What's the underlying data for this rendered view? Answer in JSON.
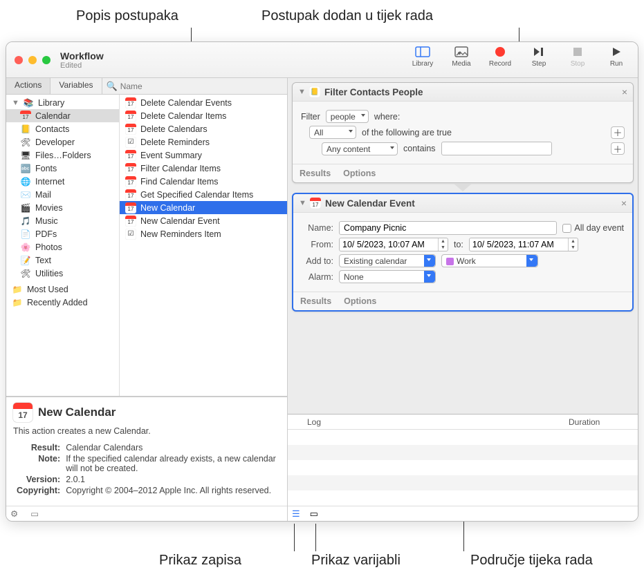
{
  "callouts": {
    "top_left": "Popis postupaka",
    "top_right": "Postupak dodan u tijek rada",
    "bottom_left": "Prikaz zapisa",
    "bottom_mid": "Prikaz varijabli",
    "bottom_right": "Područje tijeka rada"
  },
  "window": {
    "title": "Workflow",
    "subtitle": "Edited"
  },
  "toolbar": {
    "library": "Library",
    "media": "Media",
    "record": "Record",
    "step": "Step",
    "stop": "Stop",
    "run": "Run"
  },
  "tabs": {
    "actions": "Actions",
    "variables": "Variables",
    "search_placeholder": "Name"
  },
  "sidebar": {
    "library": "Library",
    "items": [
      "Calendar",
      "Contacts",
      "Developer",
      "Files…Folders",
      "Fonts",
      "Internet",
      "Mail",
      "Movies",
      "Music",
      "PDFs",
      "Photos",
      "Text",
      "Utilities"
    ],
    "extra": [
      "Most Used",
      "Recently Added"
    ]
  },
  "actions_list": [
    "Delete Calendar Events",
    "Delete Calendar Items",
    "Delete Calendars",
    "Delete Reminders",
    "Event Summary",
    "Filter Calendar Items",
    "Find Calendar Items",
    "Get Specified Calendar Items",
    "New Calendar",
    "New Calendar Event",
    "New Reminders Item"
  ],
  "actions_selected": "New Calendar",
  "info": {
    "icon_day": "17",
    "title": "New Calendar",
    "desc": "This action creates a new Calendar.",
    "rows": {
      "Result": "Calendar Calendars",
      "Note": "If the specified calendar already exists, a new calendar will not be created.",
      "Version": "2.0.1",
      "Copyright": "Copyright © 2004–2012 Apple Inc.  All rights reserved."
    }
  },
  "wf": {
    "card1": {
      "title": "Filter Contacts People",
      "filter_label": "Filter",
      "filter_sel": "people",
      "where": "where:",
      "all": "All",
      "following": "of the following are true",
      "any_content": "Any content",
      "contains": "contains",
      "results": "Results",
      "options": "Options"
    },
    "card2": {
      "title": "New Calendar Event",
      "name_label": "Name:",
      "name_value": "Company Picnic",
      "allday": "All day event",
      "from_label": "From:",
      "from_value": "10/ 5/2023, 10:07 AM",
      "to_label": "to:",
      "to_value": "10/ 5/2023, 11:07 AM",
      "addto_label": "Add to:",
      "addto_sel": "Existing calendar",
      "work_sel": "Work",
      "alarm_label": "Alarm:",
      "alarm_sel": "None",
      "results": "Results",
      "options": "Options"
    }
  },
  "log": {
    "col1": "Log",
    "col2": "Duration"
  }
}
